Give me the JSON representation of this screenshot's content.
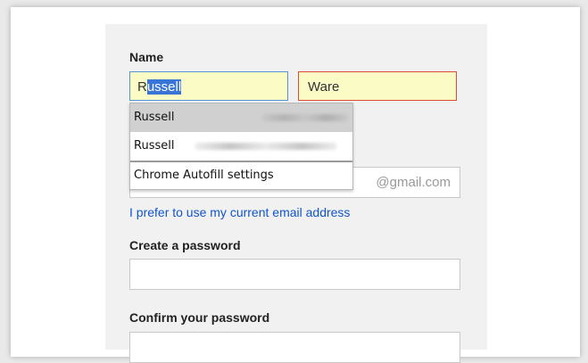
{
  "form": {
    "name_label": "Name",
    "first_name": {
      "highlight_prefix": "R",
      "selected_text": "ussell"
    },
    "last_name": "Ware",
    "email_suffix": "@gmail.com",
    "prefer_link": "I prefer to use my current email address",
    "create_password_label": "Create a password",
    "confirm_password_label": "Confirm your password"
  },
  "autofill": {
    "suggestions": [
      {
        "name": "Russell",
        "highlighted": true
      },
      {
        "name": "Russell",
        "highlighted": false
      }
    ],
    "settings_label": "Chrome Autofill settings"
  },
  "colors": {
    "autofill_bg": "#fbfbc6",
    "focus_border": "#5592d8",
    "error_border": "#dd4b39",
    "selection": "#3875d7",
    "link": "#1155cc"
  }
}
